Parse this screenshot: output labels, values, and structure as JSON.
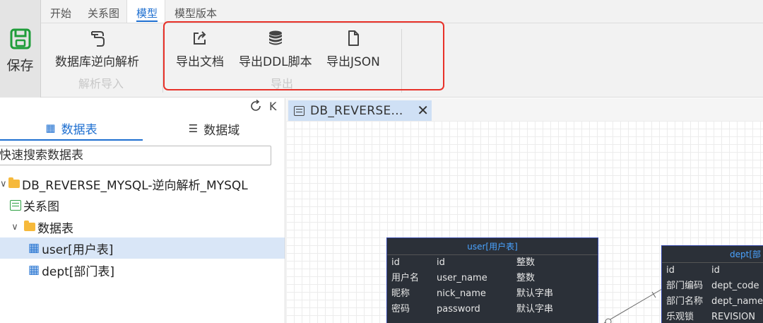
{
  "ribbon": {
    "save_label": "保存",
    "menu_tabs": [
      "开始",
      "关系图",
      "模型",
      "模型版本"
    ],
    "groups": {
      "parse_import": {
        "name": "解析导入",
        "buttons": [
          "数据库逆向解析"
        ]
      },
      "export": {
        "name": "导出",
        "buttons": [
          "导出文档",
          "导出DDL脚本",
          "导出JSON"
        ]
      }
    },
    "highlight_color": "#e8322a"
  },
  "sidebar": {
    "refresh_icon": "refresh-icon",
    "collapse_label": "K",
    "tabs": [
      "数据表",
      "数据域"
    ],
    "search_placeholder": "快速搜索数据表",
    "tree": {
      "root": "DB_REVERSE_MYSQL-逆向解析_MYSQL",
      "relation_diagram": "关系图",
      "tables_folder": "数据表",
      "tables": [
        "user[用户表]",
        "dept[部门表]"
      ]
    }
  },
  "editor": {
    "tab_title": "DB_REVERSE...",
    "entities": {
      "user": {
        "title": "user[用户表]",
        "rows": [
          [
            "id",
            "id",
            "整数"
          ],
          [
            "用户名",
            "user_name",
            "整数"
          ],
          [
            "昵称",
            "nick_name",
            "默认字串"
          ],
          [
            "密码",
            "password",
            "默认字串"
          ]
        ]
      },
      "dept": {
        "title": "dept[部",
        "rows": [
          [
            "id",
            "id"
          ],
          [
            "部门编码",
            "dept_code"
          ],
          [
            "部门名称",
            "dept_name"
          ],
          [
            "乐观锁",
            "REVISION"
          ]
        ]
      }
    }
  }
}
